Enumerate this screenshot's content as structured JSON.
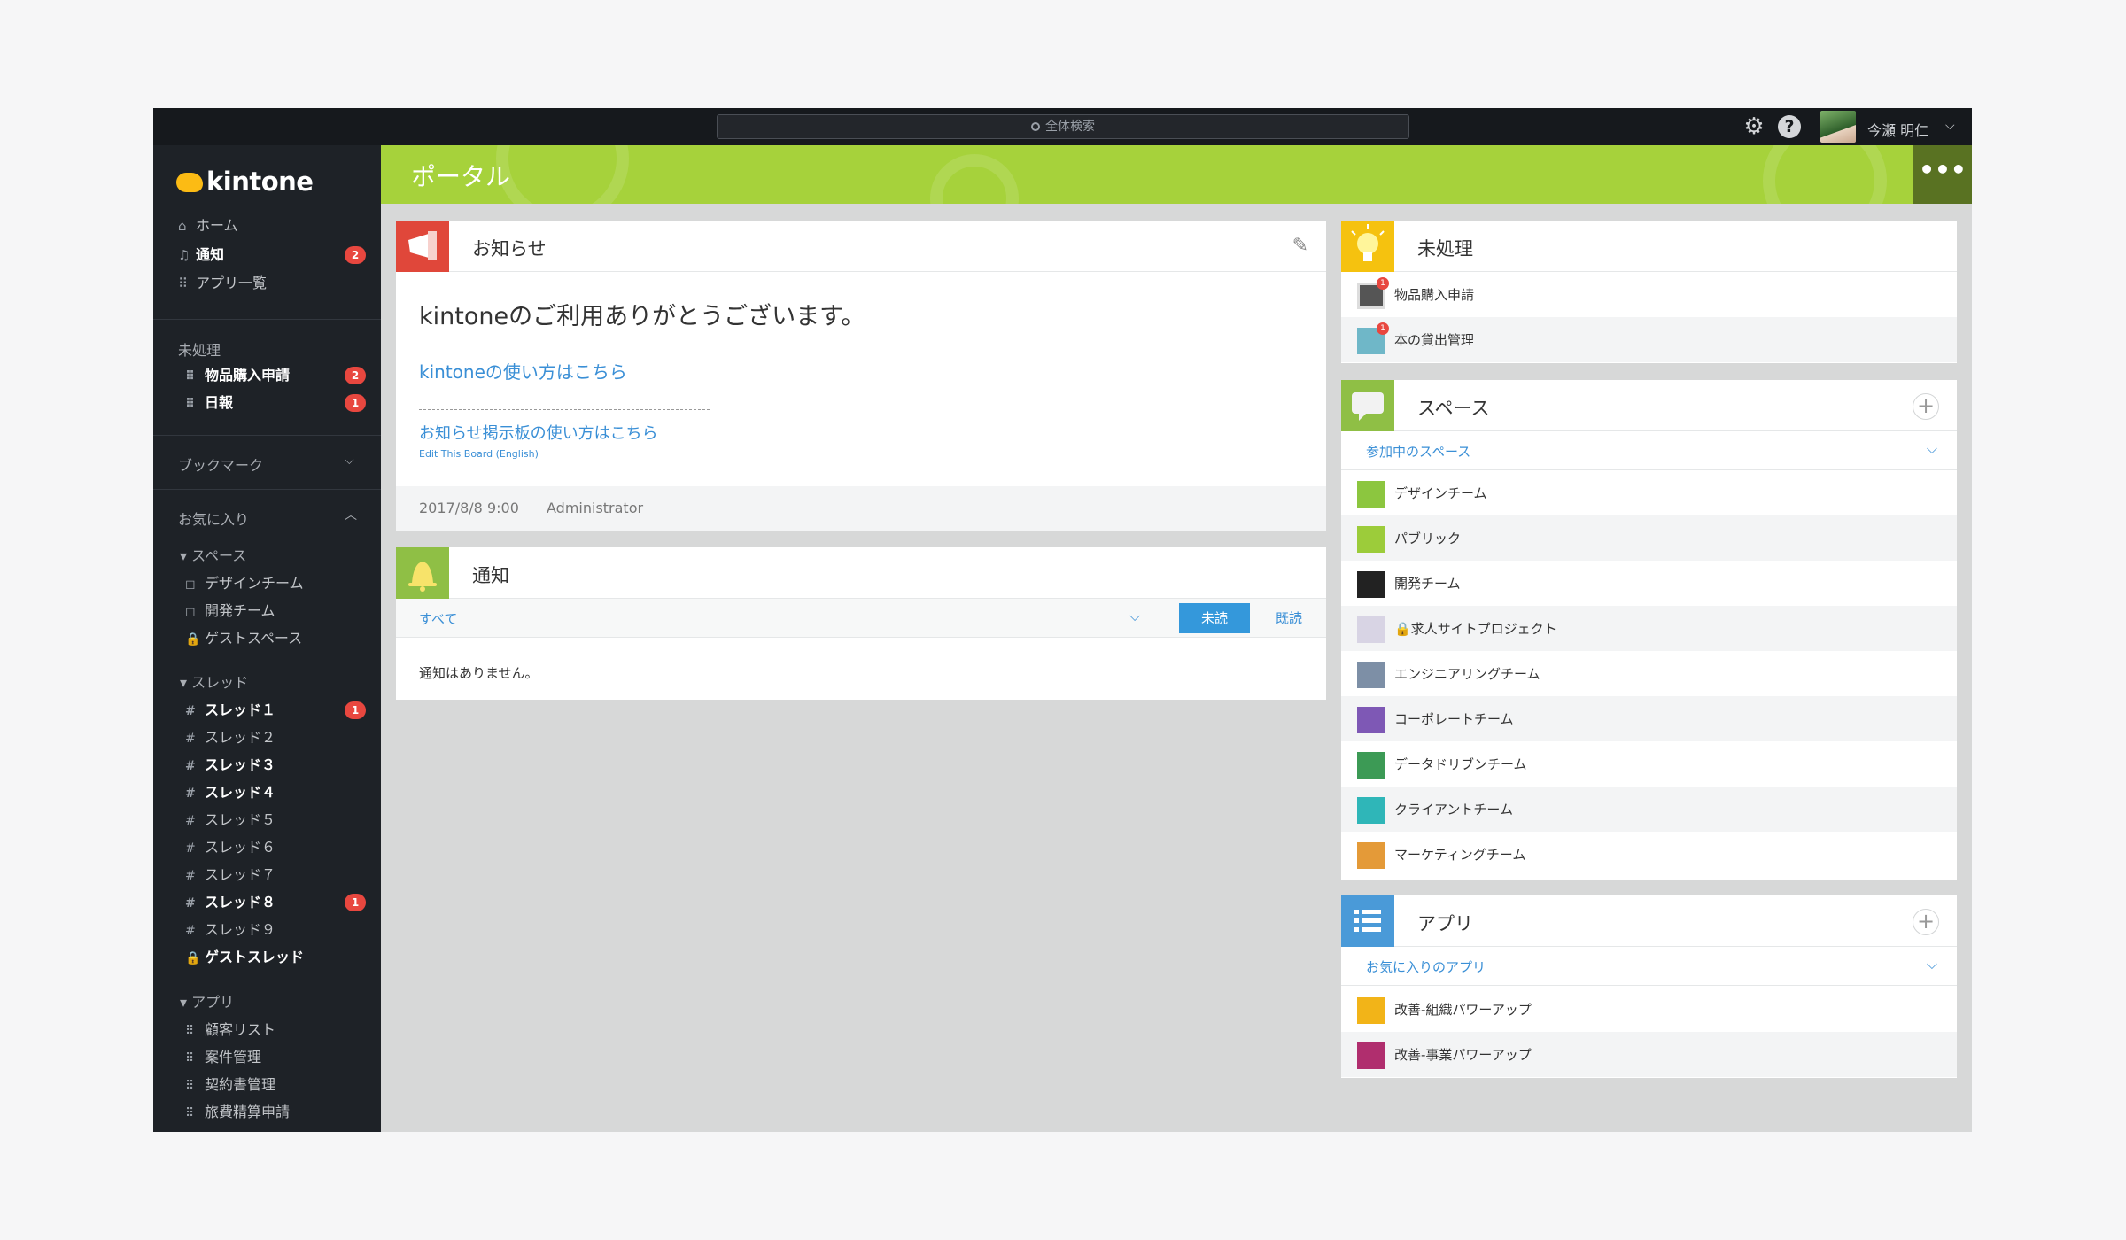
{
  "topbar": {
    "search_placeholder": "全体検索",
    "user_name": "今瀬 明仁"
  },
  "sidebar": {
    "logo": "kintone",
    "nav": [
      {
        "label": "ホーム",
        "icon": "⌂",
        "badge": ""
      },
      {
        "label": "通知",
        "icon": "🔔",
        "badge": "2"
      },
      {
        "label": "アプリ一覧",
        "icon": "⠿",
        "badge": ""
      }
    ],
    "pending_label": "未処理",
    "pending_items": [
      {
        "label": "物品購入申請",
        "badge": "2"
      },
      {
        "label": "日報",
        "badge": "1"
      }
    ],
    "bookmark_label": "ブックマーク",
    "favorites_label": "お気に入り",
    "spaces_label": "スペース",
    "spaces": [
      {
        "label": "デザインチーム",
        "icon": "◻"
      },
      {
        "label": "開発チーム",
        "icon": "◻"
      },
      {
        "label": "ゲストスペース",
        "icon": "🔒"
      }
    ],
    "threads_label": "スレッド",
    "threads": [
      {
        "label": "スレッド１",
        "bold": true,
        "badge": "1"
      },
      {
        "label": "スレッド２",
        "bold": false,
        "badge": ""
      },
      {
        "label": "スレッド３",
        "bold": true,
        "badge": ""
      },
      {
        "label": "スレッド４",
        "bold": true,
        "badge": ""
      },
      {
        "label": "スレッド５",
        "bold": false,
        "badge": ""
      },
      {
        "label": "スレッド６",
        "bold": false,
        "badge": ""
      },
      {
        "label": "スレッド７",
        "bold": false,
        "badge": ""
      },
      {
        "label": "スレッド８",
        "bold": true,
        "badge": "1"
      },
      {
        "label": "スレッド９",
        "bold": false,
        "badge": ""
      },
      {
        "label": "ゲストスレッド",
        "bold": true,
        "badge": "",
        "lock": true
      }
    ],
    "apps_label": "アプリ",
    "apps": [
      "顧客リスト",
      "案件管理",
      "契約書管理",
      "旅費精算申請"
    ]
  },
  "header": {
    "title": "ポータル"
  },
  "announcement": {
    "title": "お知らせ",
    "heading": "kintoneのご利用ありがとうございます。",
    "link1": "kintoneの使い方はこちら",
    "link2": "お知らせ掲示板の使い方はこちら",
    "link3": "Edit This Board (English)",
    "date": "2017/8/8 9:00",
    "author": "Administrator"
  },
  "notifications": {
    "title": "通知",
    "filter": "すべて",
    "unread_label": "未読",
    "read_label": "既読",
    "empty": "通知はありません。"
  },
  "pending_panel": {
    "title": "未処理",
    "items": [
      {
        "label": "物品購入申請",
        "badge": "1"
      },
      {
        "label": "本の貸出管理",
        "badge": "1"
      }
    ]
  },
  "spaces_panel": {
    "title": "スペース",
    "filter": "参加中のスペース",
    "items": [
      {
        "label": "デザインチーム",
        "color": "#8cc63f"
      },
      {
        "label": "パブリック",
        "color": "#9ccc3a"
      },
      {
        "label": "開発チーム",
        "color": "#222222"
      },
      {
        "label": "🔒求人サイトプロジェクト",
        "color": "#d8d4e4"
      },
      {
        "label": "エンジニアリングチーム",
        "color": "#7d8fa6"
      },
      {
        "label": "コーポレートチーム",
        "color": "#7e58b5"
      },
      {
        "label": "データドリブンチーム",
        "color": "#3c9a55"
      },
      {
        "label": "クライアントチーム",
        "color": "#2fb6b8"
      },
      {
        "label": "マーケティングチーム",
        "color": "#e49a38"
      }
    ]
  },
  "apps_panel": {
    "title": "アプリ",
    "filter": "お気に入りのアプリ",
    "items": [
      {
        "label": "改善-組織パワーアップ",
        "color": "#f2b418"
      },
      {
        "label": "改善-事業パワーアップ",
        "color": "#b02e6e"
      }
    ]
  }
}
